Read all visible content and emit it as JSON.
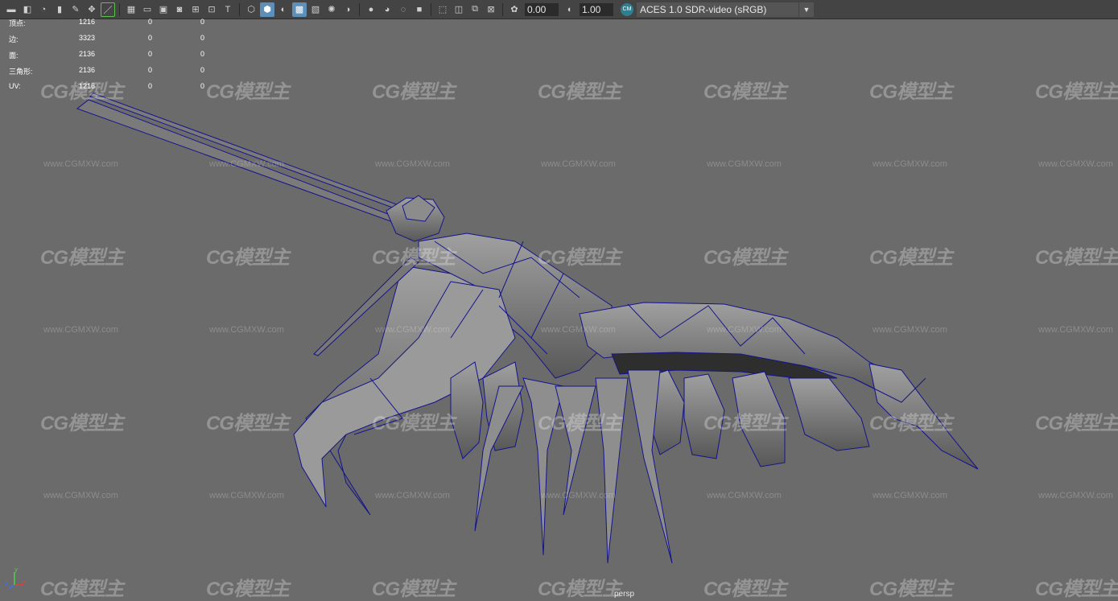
{
  "toolbar": {
    "icons": [
      "camera-icon",
      "camera-lock-icon",
      "camera-orbit-icon",
      "bookmark-icon",
      "grease-pencil-icon",
      "pan-zoom-icon",
      "two-d-pan-icon",
      "grid-icon",
      "film-gate-icon",
      "resolution-gate-icon",
      "gate-mask-icon",
      "field-chart-icon",
      "safe-action-icon",
      "safe-title-icon",
      "wireframe-icon",
      "smooth-shade-icon",
      "default-material-icon",
      "wireframe-on-shaded-icon",
      "textured-icon",
      "use-all-lights-icon",
      "shadows-icon",
      "screen-space-ao-icon",
      "motion-blur-icon",
      "anti-aliasing-icon",
      "depth-of-field-icon",
      "isolate-select-icon",
      "xray-icon",
      "xray-joints-icon",
      "xray-active-icon",
      "backface-icon"
    ],
    "exposure_value": "0.00",
    "gamma_value": "1.00",
    "color_management_badge": "CM",
    "color_space": "ACES 1.0 SDR-video (sRGB)"
  },
  "hud": {
    "rows": [
      {
        "label": "顶点:",
        "v1": "1216",
        "v2": "0",
        "v3": "0"
      },
      {
        "label": "边:",
        "v1": "3323",
        "v2": "0",
        "v3": "0"
      },
      {
        "label": "面:",
        "v1": "2136",
        "v2": "0",
        "v3": "0"
      },
      {
        "label": "三角形:",
        "v1": "2136",
        "v2": "0",
        "v3": "0"
      },
      {
        "label": "UV:",
        "v1": "1216",
        "v2": "0",
        "v3": "0"
      }
    ]
  },
  "watermark": {
    "logo": "CG模型主",
    "url": "www.CGMXW.com"
  },
  "viewport": {
    "camera": "persp",
    "axis": {
      "x": "x",
      "y": "y",
      "z": "z"
    },
    "colors": {
      "background": "#6b6b6b",
      "mesh": "#8a8a8a",
      "wire": "#14148c"
    }
  }
}
